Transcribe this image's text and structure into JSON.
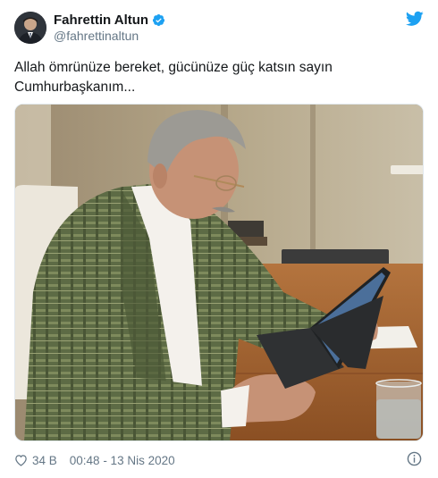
{
  "author": {
    "display_name": "Fahrettin Altun",
    "handle": "@fahrettinaltun",
    "verified": true,
    "avatar_icon": "profile-avatar"
  },
  "tweet": {
    "text_line1": "Allah ömrünüze bereket, gücünüze güç katsın sayın",
    "text_line2": "Cumhurbaşkanım..."
  },
  "footer": {
    "likes": "34 B",
    "timestamp": "00:48 - 13 Nis 2020"
  },
  "icons": {
    "brand": "twitter-bird-icon",
    "like": "heart-icon",
    "info": "info-icon",
    "verified": "verified-badge-icon"
  },
  "colors": {
    "twitter_blue": "#1da1f2",
    "text_primary": "#14171a",
    "text_secondary": "#657786"
  }
}
